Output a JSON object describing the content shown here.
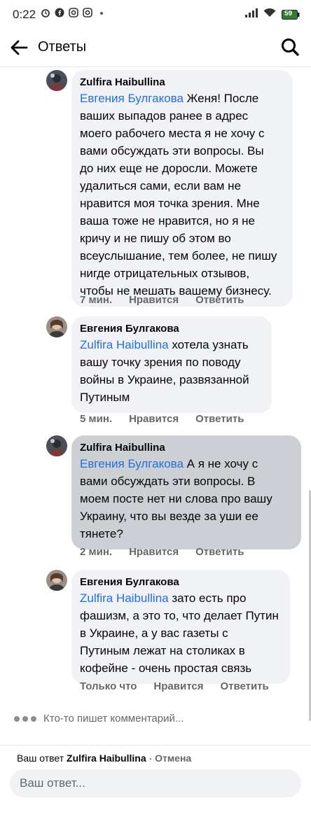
{
  "status_bar": {
    "time": "0:22",
    "battery": "59"
  },
  "header": {
    "title": "Ответы"
  },
  "comments": [
    {
      "author": "Zulfira Haibullina",
      "mention": "Евгения Булгакова",
      "lines": [
        " Женя! После",
        "ваших выпадов ранее в адрес",
        "моего рабочего места я не хочу с",
        "вами обсуждать эти вопросы. Вы",
        "до них еще не доросли. Можете",
        "удалиться сами, если вам не",
        "нравится моя точка зрения. Мне",
        "ваша тоже не нравится, но я не",
        "кричу и не пишу об этом во",
        "всеуслышание, тем более, не пишу",
        "нигде отрицательных отзывов,",
        "чтобы не мешать вашему бизнесу."
      ],
      "time": "7 мин.",
      "like": "Нравится",
      "reply": "Ответить"
    },
    {
      "author": "Евгения Булгакова",
      "mention": "Zulfira Haibullina",
      "lines": [
        " хотела узнать",
        "вашу точку зрения по поводу",
        "войны в Украине, развязанной",
        "Путиным"
      ],
      "time": "5 мин.",
      "like": "Нравится",
      "reply": "Ответить"
    },
    {
      "author": "Zulfira Haibullina",
      "mention": "Евгения Булгакова",
      "lines": [
        " А я не хочу с",
        "вами обсуждать эти вопросы. В",
        "моем посте нет ни слова про вашу",
        "Украину, что вы везде за уши ее",
        "тянете?"
      ],
      "time": "2 мин.",
      "like": "Нравится",
      "reply": "Ответить"
    },
    {
      "author": "Евгения Булгакова",
      "mention": "Zulfira Haibullina",
      "lines": [
        " зато есть про",
        "фашизм, а это то, что делает Путин",
        "в Украине, а у вас газеты с",
        "Путиным лежат на столиках в",
        "кофейне - очень простая связь"
      ],
      "time": "Только что",
      "like": "Нравится",
      "reply": "Ответить"
    }
  ],
  "typing_indicator": "Кто-то пишет комментарий...",
  "composer": {
    "reply_prefix": "Ваш ответ",
    "reply_name": "Zulfira Haibullina",
    "separator": " · ",
    "cancel": "Отмена",
    "placeholder": "Ваш ответ..."
  },
  "colors": {
    "mention": "#216fdb",
    "bubble": "#f0f2f5",
    "bubble_highlight": "#ccd0d5"
  }
}
